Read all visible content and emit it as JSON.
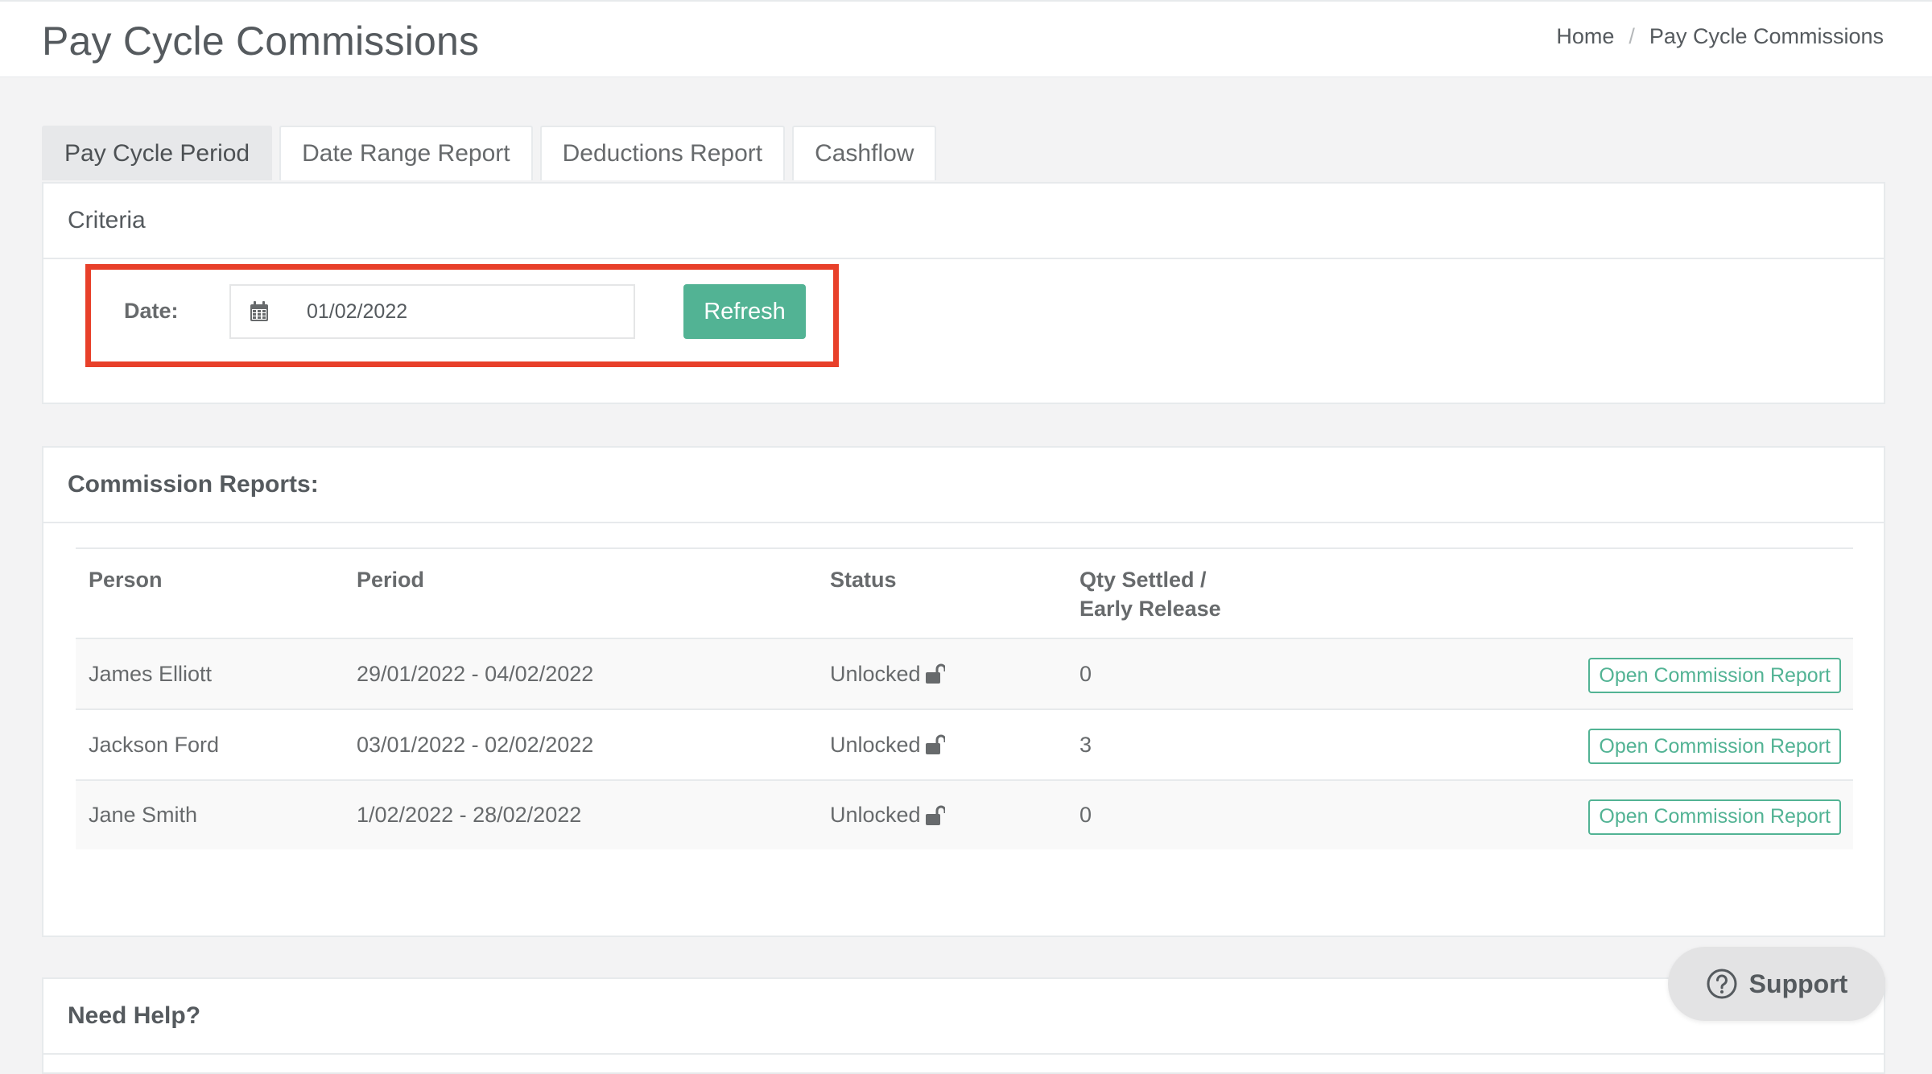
{
  "header": {
    "title": "Pay Cycle Commissions",
    "breadcrumb": [
      "Home",
      "Pay Cycle Commissions"
    ]
  },
  "tabs": [
    {
      "label": "Pay Cycle Period",
      "active": true
    },
    {
      "label": "Date Range Report",
      "active": false
    },
    {
      "label": "Deductions Report",
      "active": false
    },
    {
      "label": "Cashflow",
      "active": false
    }
  ],
  "criteria": {
    "title": "Criteria",
    "date_label": "Date:",
    "date_value": "01/02/2022",
    "refresh_label": "Refresh"
  },
  "reports": {
    "title": "Commission Reports:",
    "columns": {
      "person": "Person",
      "period": "Period",
      "status": "Status",
      "qty_line1": "Qty Settled /",
      "qty_line2": "Early Release"
    },
    "rows": [
      {
        "person": "James Elliott",
        "period": "29/01/2022 - 04/02/2022",
        "status": "Unlocked",
        "qty": "0",
        "action": "Open Commission Report"
      },
      {
        "person": "Jackson Ford",
        "period": "03/01/2022 - 02/02/2022",
        "status": "Unlocked",
        "qty": "3",
        "action": "Open Commission Report"
      },
      {
        "person": "Jane Smith",
        "period": "1/02/2022 - 28/02/2022",
        "status": "Unlocked",
        "qty": "0",
        "action": "Open Commission Report"
      }
    ]
  },
  "help": {
    "title": "Need Help?"
  },
  "support": {
    "label": "Support"
  },
  "colors": {
    "accent": "#52b394",
    "highlight": "#e8402a"
  }
}
